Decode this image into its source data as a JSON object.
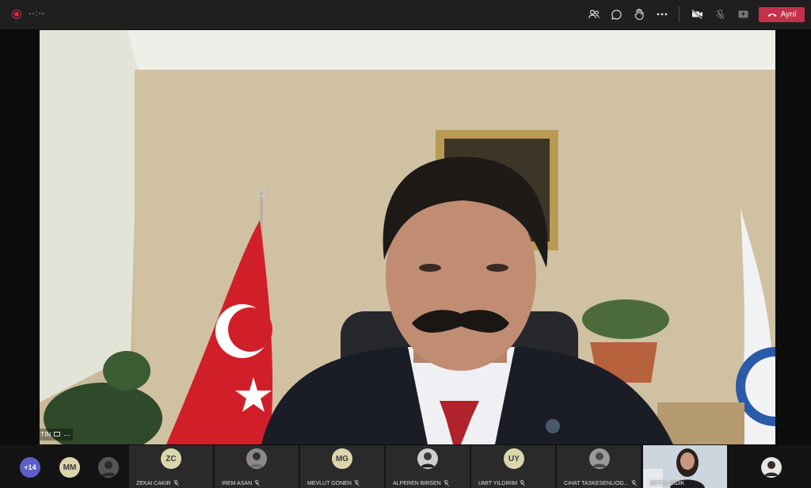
{
  "toolbar": {
    "timer": "--:--",
    "leave_label": "Ayrıl",
    "icons": [
      "participants-icon",
      "chat-icon",
      "raise-hand-icon",
      "more-icon",
      "camera-off-icon",
      "mic-off-icon",
      "share-screen-icon"
    ],
    "leave_color": "#c4314b"
  },
  "stage": {
    "speaker_name": "RAFET METIN"
  },
  "strip": {
    "overflow_count": "+14",
    "tiles": [
      {
        "initials": "MM",
        "name": ""
      },
      {
        "initials": "",
        "name": ""
      },
      {
        "initials": "ZC",
        "name": "ZEKAI CAKIR"
      },
      {
        "initials": "",
        "name": "IREM ASAN"
      },
      {
        "initials": "MG",
        "name": "MEVLUT GONEN"
      },
      {
        "initials": "",
        "name": "ALPEREN BIRSEN"
      },
      {
        "initials": "UY",
        "name": "UMIT YILDIRIM"
      },
      {
        "initials": "",
        "name": "CIHAT TASKESENLIOG..."
      },
      {
        "initials": "",
        "name": "BETUL GIDIK"
      },
      {
        "initials": "",
        "name": ""
      }
    ]
  },
  "colors": {
    "toolbar_bg": "#1f1f1f",
    "initials_avatar": "#dcd6ad",
    "overflow_avatar": "#5b5fc7"
  }
}
